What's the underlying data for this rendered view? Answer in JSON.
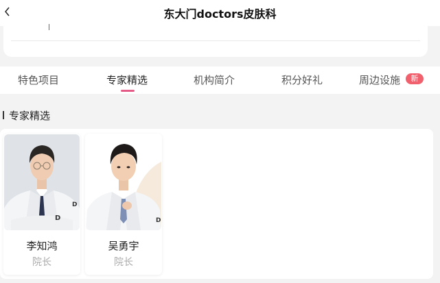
{
  "header": {
    "title": "东大门doctors皮肤科",
    "back_icon": "chevron-left-icon"
  },
  "tabs": [
    {
      "label": "特色项目",
      "active": false
    },
    {
      "label": "专家精选",
      "active": true
    },
    {
      "label": "机构简介",
      "active": false
    },
    {
      "label": "积分好礼",
      "active": false
    },
    {
      "label": "周边设施",
      "active": false,
      "badge": "新"
    }
  ],
  "section": {
    "title": "专家精选"
  },
  "experts": [
    {
      "name": "李知鸿",
      "role": "院长",
      "photo": "doctor-portrait-glasses"
    },
    {
      "name": "吴勇宇",
      "role": "院长",
      "photo": "doctor-portrait-tie"
    }
  ],
  "colors": {
    "accent": "#e55b87",
    "badge": "#f0616d",
    "background": "#f3f3f3"
  }
}
